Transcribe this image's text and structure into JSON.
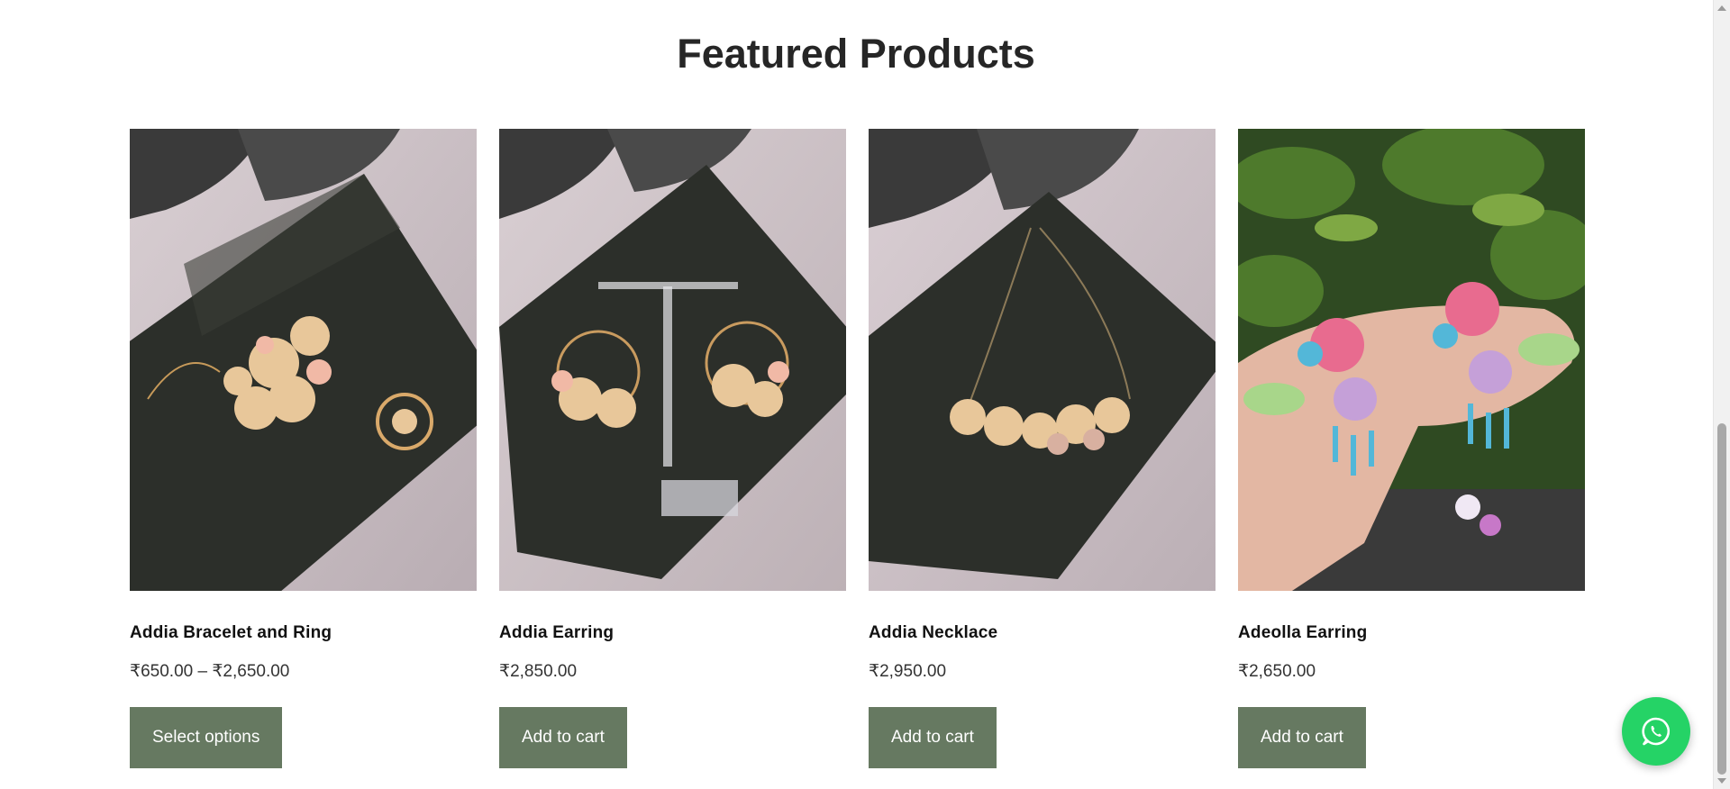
{
  "section": {
    "title": "Featured Products"
  },
  "products": [
    {
      "name": "Addia Bracelet and Ring",
      "price": "₹650.00 – ₹2,650.00",
      "button": "Select options"
    },
    {
      "name": "Addia Earring",
      "price": "₹2,850.00",
      "button": "Add to cart"
    },
    {
      "name": "Addia Necklace",
      "price": "₹2,950.00",
      "button": "Add to cart"
    },
    {
      "name": "Adeolla Earring",
      "price": "₹2,650.00",
      "button": "Add to cart"
    }
  ],
  "colors": {
    "button_bg": "#667961",
    "whatsapp": "#25d366",
    "title": "#262626"
  },
  "icons": {
    "chat": "whatsapp-icon"
  }
}
